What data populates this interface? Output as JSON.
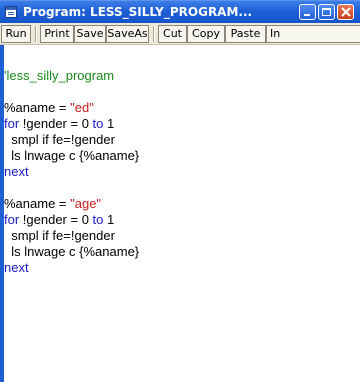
{
  "window": {
    "title": "Program: LESS_SILLY_PROGRAM..."
  },
  "toolbar": {
    "buttons": [
      "Run",
      "Print",
      "Save",
      "SaveAs",
      "Cut",
      "Copy",
      "Paste",
      "In"
    ]
  },
  "code": {
    "line1": "'less_silly_program",
    "block1": {
      "assign_var": "%aname = ",
      "assign_str": "\"ed\"",
      "for_kw": "for",
      "for_mid": " !gender = 0 ",
      "to_kw": "to",
      "for_end": " 1",
      "smpl": "  smpl if fe=!gender",
      "ls": "  ls lnwage c {%aname}",
      "next_kw": "next"
    },
    "block2": {
      "assign_var": "%aname = ",
      "assign_str": "\"age\"",
      "for_kw": "for",
      "for_mid": " !gender = 0 ",
      "to_kw": "to",
      "for_end": " 1",
      "smpl": "  smpl if fe=!gender",
      "ls": "  ls lnwage c {%aname}",
      "next_kw": "next"
    }
  },
  "colors": {
    "comment": "#1e8c1e",
    "keyword": "#1a1acc",
    "string": "#cc1a1a",
    "title_bar": "#1f5fd6"
  }
}
